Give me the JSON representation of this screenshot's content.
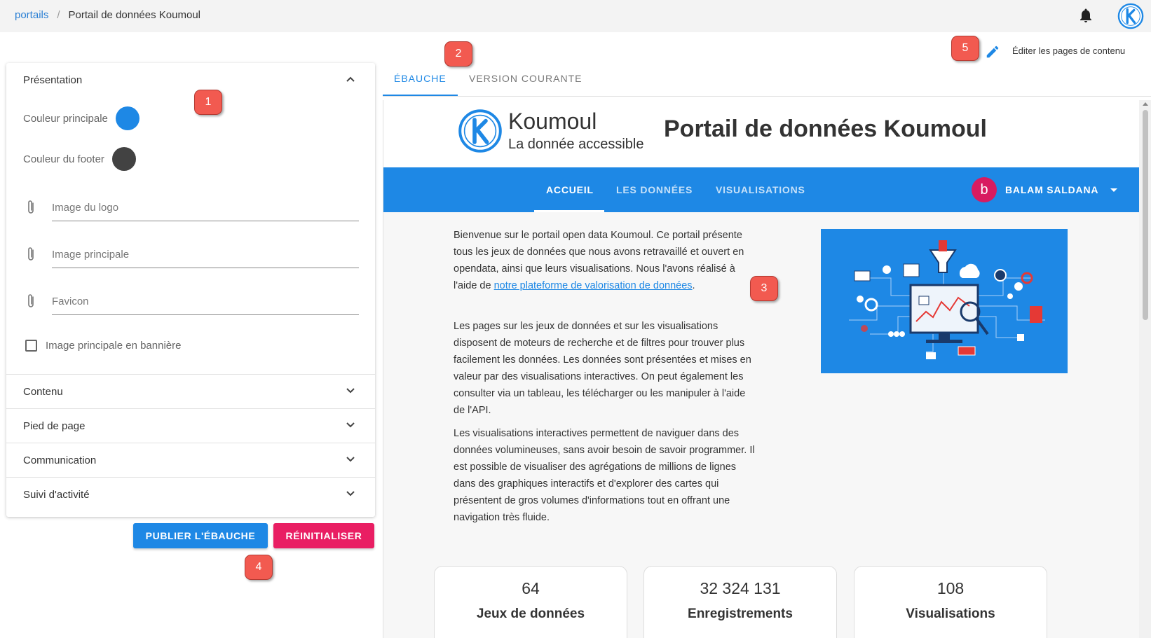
{
  "breadcrumb": {
    "root": "portails",
    "current": "Portail de données Koumoul"
  },
  "topbar": {
    "bell_icon": "bell-icon",
    "logo_letter": "K"
  },
  "badges": [
    "1",
    "2",
    "3",
    "4",
    "5"
  ],
  "panel": {
    "presentation": {
      "title": "Présentation",
      "main_color_label": "Couleur principale",
      "main_color": "#1e88e5",
      "footer_color_label": "Couleur du footer",
      "footer_color": "#424242",
      "logo_image_label": "Image du logo",
      "main_image_label": "Image principale",
      "favicon_label": "Favicon",
      "banner_checkbox_label": "Image principale en bannière"
    },
    "sections": [
      "Contenu",
      "Pied de page",
      "Communication",
      "Suivi d'activité"
    ]
  },
  "actions": {
    "publish": "PUBLIER L'ÉBAUCHE",
    "reset": "RÉINITIALISER"
  },
  "edit_link": "Éditer les pages de contenu",
  "tabs": {
    "draft": "ÉBAUCHE",
    "current": "VERSION COURANTE"
  },
  "preview": {
    "brand": "Koumoul",
    "tagline": "La donnée accessible",
    "title": "Portail de données Koumoul",
    "nav": [
      "ACCUEIL",
      "LES DONNÉES",
      "VISUALISATIONS"
    ],
    "user": {
      "initial": "b",
      "name": "BALAM SALDANA"
    },
    "para1_text": "Bienvenue sur le portail open data Koumoul. Ce portail présente tous les jeux de données que nous avons retravaillé et ouvert en opendata, ainsi que leurs visualisations. Nous l'avons réalisé à l'aide de ",
    "para1_link": "notre plateforme de valorisation de données",
    "para1_end": ".",
    "para2": "Les pages sur les jeux de données et sur les visualisations disposent de moteurs de recherche et de filtres pour trouver plus facilement les données. Les données sont présentées et mises en valeur par des visualisations interactives. On peut également les consulter via un tableau, les télécharger ou les manipuler à l'aide de l'API.",
    "para3": "Les visualisations interactives permettent de naviguer dans des données volumineuses, sans avoir besoin de savoir programmer. Il est possible de visualiser des agrégations de millions de lignes dans des graphiques interactifs et d'explorer des cartes qui présentent de gros volumes d'informations tout en offrant une navigation très fluide.",
    "stats": [
      {
        "value": "64",
        "label": "Jeux de données"
      },
      {
        "value": "32 324 131",
        "label": "Enregistrements"
      },
      {
        "value": "108",
        "label": "Visualisations"
      }
    ]
  }
}
